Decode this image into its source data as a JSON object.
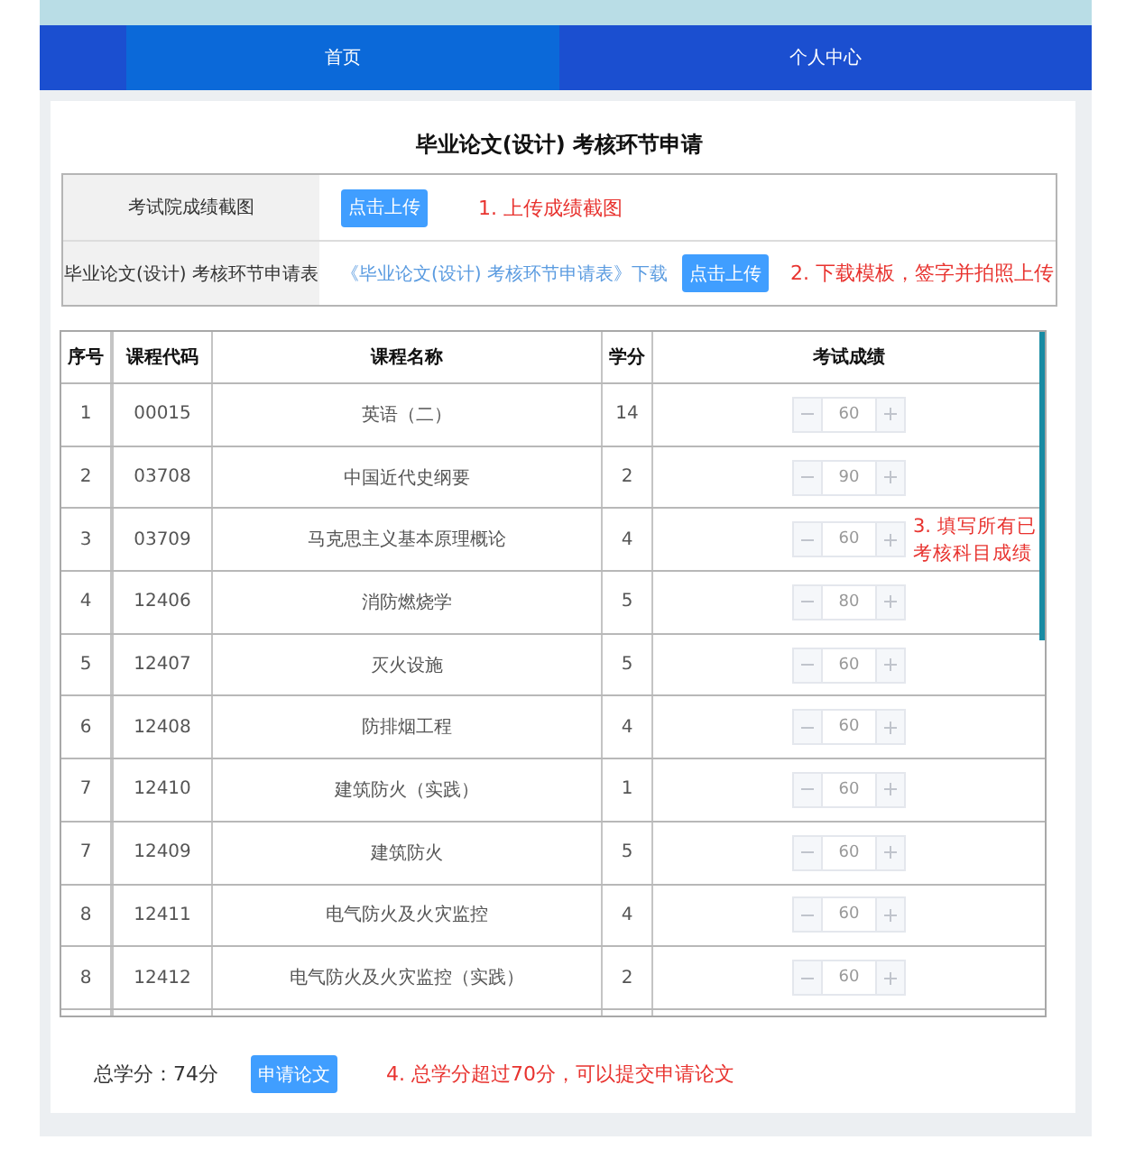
{
  "nav": {
    "tabs": [
      {
        "label": "首页",
        "selected": true
      },
      {
        "label": "个人中心",
        "selected": false
      }
    ]
  },
  "title": "毕业论文(设计) 考核环节申请",
  "uploads": [
    {
      "label": "考试院成绩截图",
      "button": "点击上传",
      "note": "1. 上传成绩截图"
    },
    {
      "label": "毕业论文(设计) 考核环节申请表",
      "link": "《毕业论文(设计) 考核环节申请表》下载",
      "button": "点击上传",
      "note": "2. 下载模板，签字并拍照上传"
    }
  ],
  "table": {
    "columns": [
      "序号",
      "课程代码",
      "课程名称",
      "学分",
      "考试成绩"
    ],
    "rows": [
      {
        "index": "1",
        "code": "00015",
        "name": "英语（二）",
        "credits": "14",
        "score": "60"
      },
      {
        "index": "2",
        "code": "03708",
        "name": "中国近代史纲要",
        "credits": "2",
        "score": "90"
      },
      {
        "index": "3",
        "code": "03709",
        "name": "马克思主义基本原理概论",
        "credits": "4",
        "score": "60"
      },
      {
        "index": "4",
        "code": "12406",
        "name": "消防燃烧学",
        "credits": "5",
        "score": "80"
      },
      {
        "index": "5",
        "code": "12407",
        "name": "灭火设施",
        "credits": "5",
        "score": "60"
      },
      {
        "index": "6",
        "code": "12408",
        "name": "防排烟工程",
        "credits": "4",
        "score": "60"
      },
      {
        "index": "7",
        "code": "12410",
        "name": "建筑防火（实践）",
        "credits": "1",
        "score": "60"
      },
      {
        "index": "7",
        "code": "12409",
        "name": "建筑防火",
        "credits": "5",
        "score": "60"
      },
      {
        "index": "8",
        "code": "12411",
        "name": "电气防火及火灾监控",
        "credits": "4",
        "score": "60"
      },
      {
        "index": "8",
        "code": "12412",
        "name": "电气防火及火灾监控（实践）",
        "credits": "2",
        "score": "60"
      }
    ],
    "note": "3. 填写所有已考核科目成绩"
  },
  "footer": {
    "total": "总学分：74分",
    "button": "申请论文",
    "note": "4. 总学分超过70分，可以提交申请论文"
  }
}
